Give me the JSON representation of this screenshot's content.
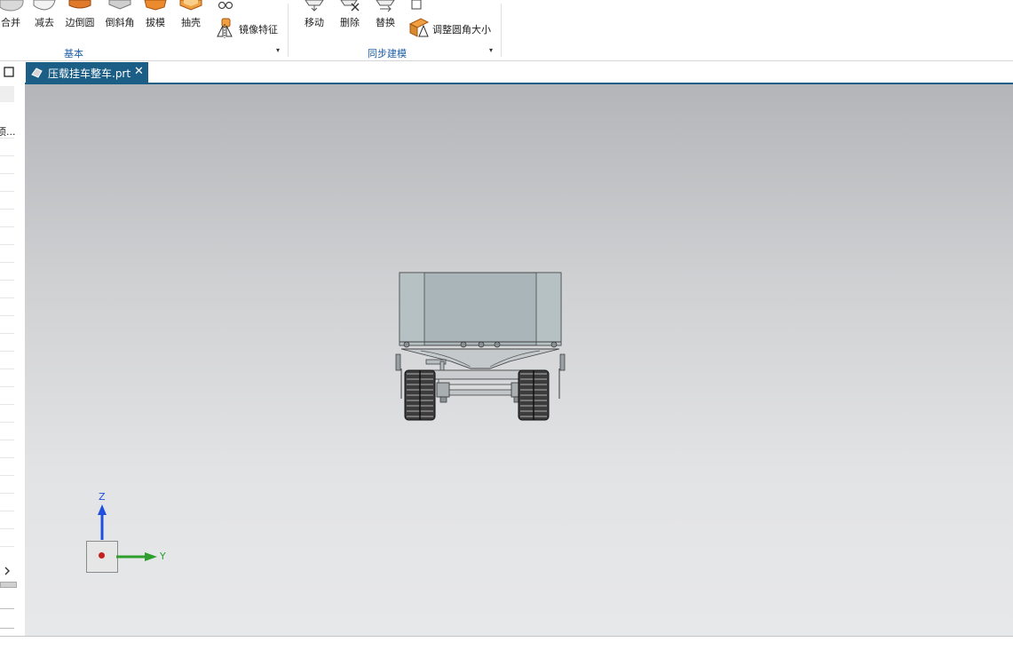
{
  "ribbon": {
    "groups": [
      {
        "label": "基本"
      },
      {
        "label": "同步建模"
      }
    ],
    "basic": {
      "combine": "合并",
      "subtract": "减去",
      "edge_blend": "边倒圆",
      "chamfer": "倒斜角",
      "draft": "拔模",
      "shell": "抽壳",
      "mirror_feature": "镜像特征"
    },
    "sync": {
      "move": "移动",
      "delete": "删除",
      "replace": "替换",
      "resize_blend": "调整圆角大小"
    }
  },
  "document_tab": {
    "label": "压载挂车整车.prt",
    "close": "✕"
  },
  "left_panel": {
    "truncated_item": "项..."
  },
  "triad": {
    "z_label": "Z",
    "y_label": "Y"
  },
  "colors": {
    "tab_bg": "#1b5e86",
    "group_label": "#1f5fa8",
    "triad_z": "#1f4fdc",
    "triad_y": "#2e9e2e"
  }
}
